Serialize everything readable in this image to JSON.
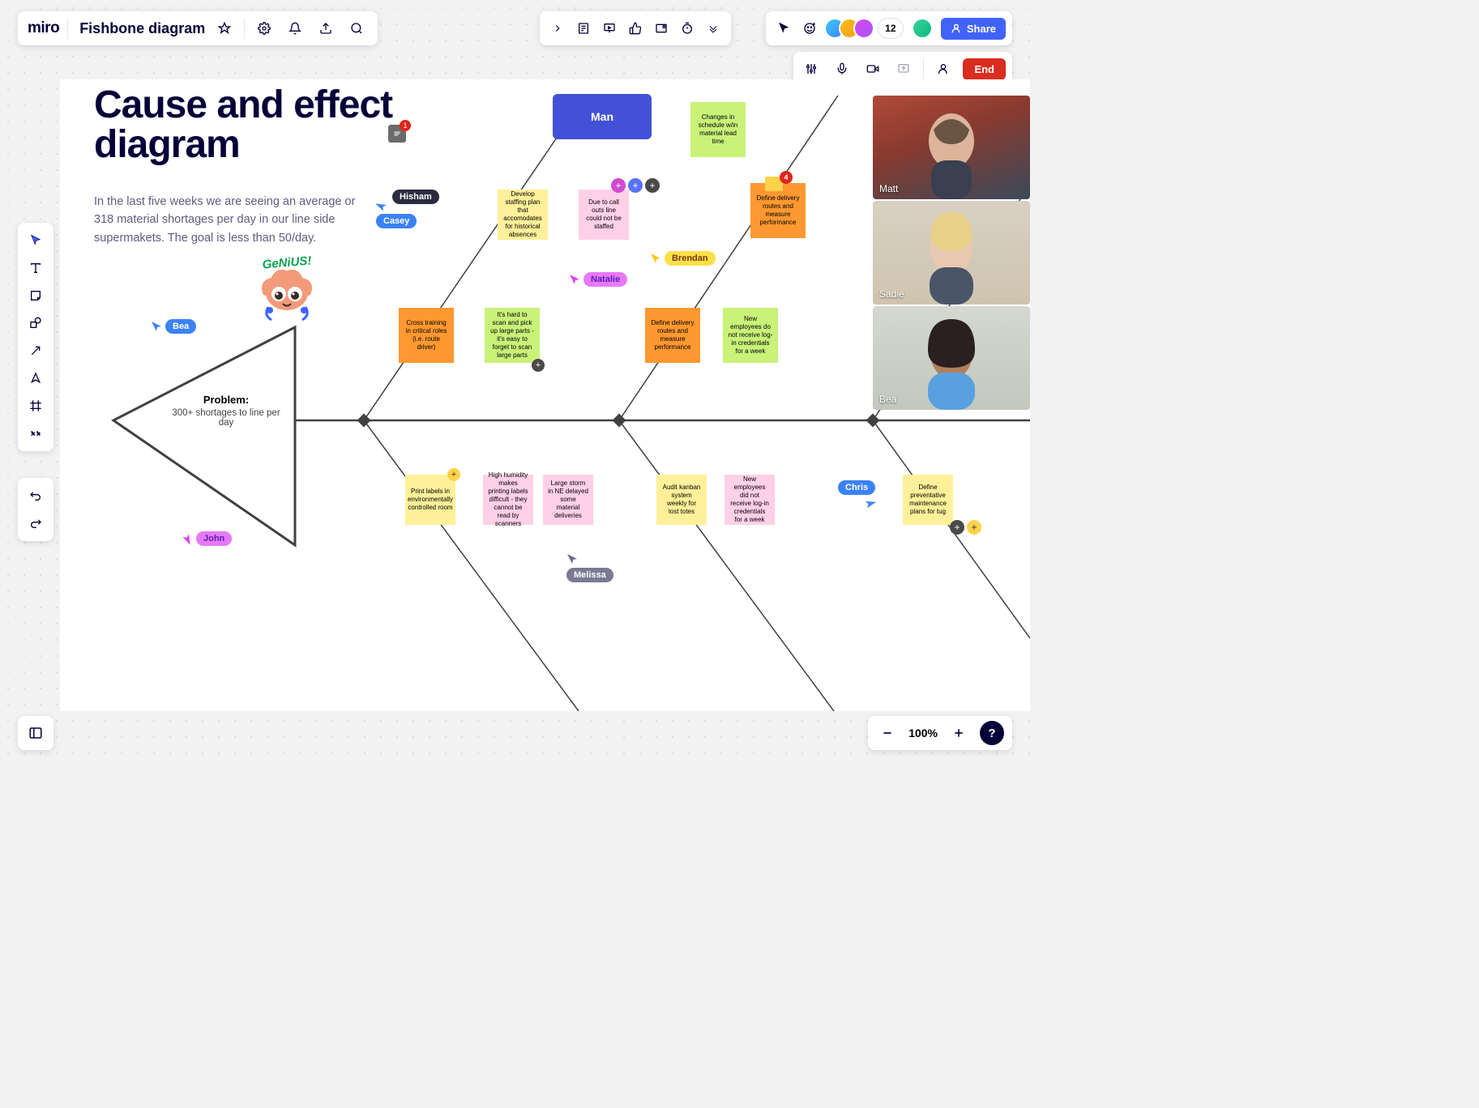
{
  "app": {
    "name": "miro",
    "board_title": "Fishbone diagram"
  },
  "toolbar_right": {
    "participants": "12",
    "share": "Share",
    "end": "End"
  },
  "video": [
    {
      "name": "Matt"
    },
    {
      "name": "Sadie"
    },
    {
      "name": "Bea"
    }
  ],
  "canvas": {
    "heading": "Cause and effect diagram",
    "description": "In the last five weeks we are seeing an average or 318 material shortages per day in our line side supermakets. The goal is less than 50/day.",
    "comment_count": "1",
    "genius": "GeNiUS!",
    "problem_label": "Problem:",
    "problem_text": "300+ shortages to line per day",
    "category_man": "Man",
    "notes": {
      "changes": "Changes in schedule w/in material lead time",
      "define1": "Define delivery routes and measure performance",
      "define1_badge": "4",
      "staff": "Develop staffing plan that accomodates for historical absences",
      "callouts": "Due to call outs line could not be staffed",
      "cross": "Cross training in critical roles (i.e. route driver)",
      "scan": "It's hard to scan and pick up large parts - it's easy to forget to scan large parts",
      "define2": "Define delivery routes and measure performance",
      "newemp1": "New employees do not receive log-in credentials for a week",
      "labels": "Print labels in environmentally controlled room",
      "humidity": "High humidity makes printing labels difficult - they cannot be read by scanners",
      "storm": "Large storm in NE delayed some material deliveries",
      "kanban": "Audit kanban system weekly for lost totes",
      "newemp2": "New employees did not receive log-in credentials for a week",
      "prevent": "Define preventative maintenance plans for tug"
    },
    "cursors": {
      "bea": "Bea",
      "casey": "Casey",
      "hisham": "Hisham",
      "natalie": "Natalie",
      "brendan": "Brendan",
      "john": "John",
      "melissa": "Melissa",
      "chris": "Chris"
    }
  },
  "zoom": "100%",
  "help": "?"
}
